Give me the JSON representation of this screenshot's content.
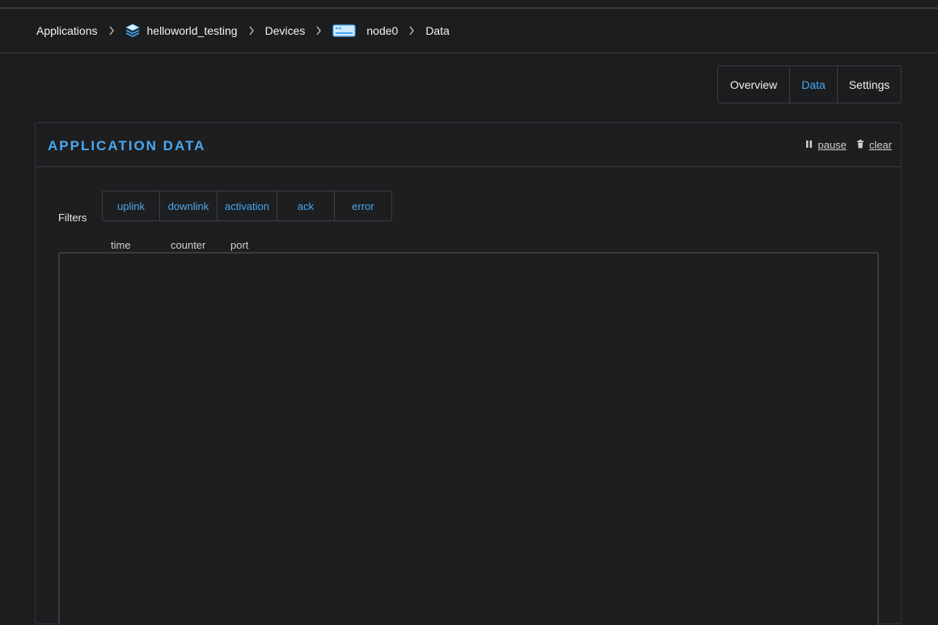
{
  "breadcrumb": {
    "items": [
      {
        "label": "Applications",
        "icon": ""
      },
      {
        "label": "helloworld_testing",
        "icon": "layers-icon"
      },
      {
        "label": "Devices",
        "icon": ""
      },
      {
        "label": "node0",
        "icon": "device-icon"
      },
      {
        "label": "Data",
        "icon": ""
      }
    ],
    "separator_icon": "chevron-right-icon"
  },
  "tabs": [
    {
      "label": "Overview",
      "active": false
    },
    {
      "label": "Data",
      "active": true
    },
    {
      "label": "Settings",
      "active": false
    }
  ],
  "panel": {
    "title": "APPLICATION DATA",
    "actions": {
      "pause_label": "pause",
      "pause_icon": "pause-icon",
      "clear_label": "clear",
      "clear_icon": "trash-icon"
    },
    "filters_label": "Filters",
    "filters": [
      "uplink",
      "downlink",
      "activation",
      "ack",
      "error"
    ],
    "columns": [
      "time",
      "counter",
      "port"
    ]
  },
  "colors": {
    "accent": "#4aa8f0",
    "background": "#1c1d1f",
    "border": "#3a3b3e"
  }
}
